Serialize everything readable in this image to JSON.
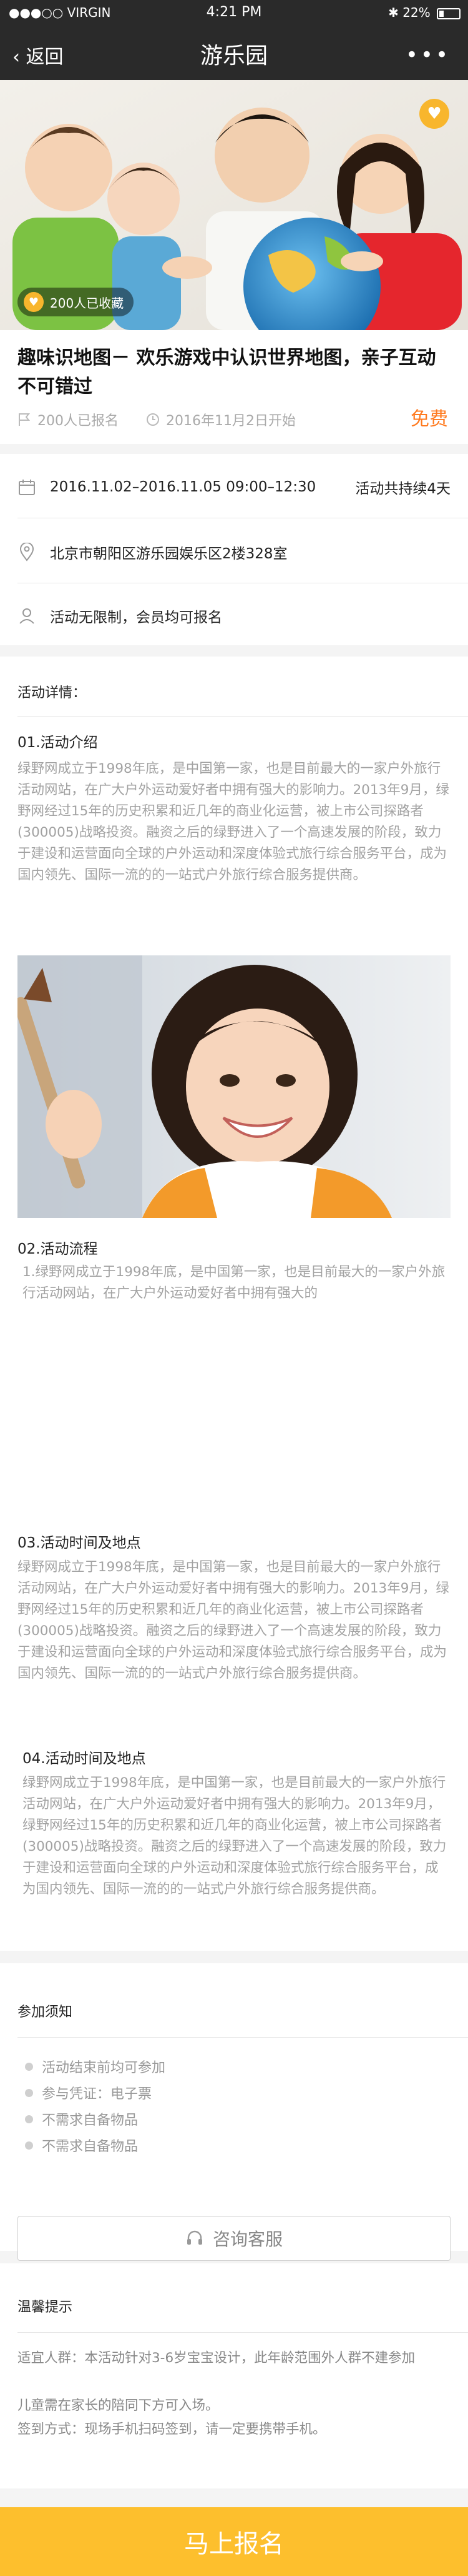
{
  "status_bar": {
    "carrier": "●●●○○ VIRGIN",
    "time": "4:21 PM",
    "battery": "22%"
  },
  "nav": {
    "back_label": "返回",
    "title": "游乐园",
    "more_label": "•••"
  },
  "hero": {
    "favorites_count": "200人已收藏"
  },
  "activity": {
    "title": "趣味识地图－ 欢乐游戏中认识世界地图，亲子互动不可错过",
    "signed_up": "200人已报名",
    "start": "2016年11月2日开始",
    "price": "免费"
  },
  "info": {
    "date_range": "2016.11.02–2016.11.05  09:00–12:30",
    "duration": "活动共持续4天",
    "address": "北京市朝阳区游乐园娱乐区2楼328室",
    "eligibility": "活动无限制，会员均可报名"
  },
  "details": {
    "heading": "活动详情：",
    "s1_title": "01.活动介绍",
    "s1_text": "绿野网成立于1998年底，是中国第一家，也是目前最大的一家户外旅行活动网站，在广大户外运动爱好者中拥有强大的影响力。2013年9月，绿野网经过15年的历史积累和近几年的商业化运营，被上市公司探路者(300005)战略投资。融资之后的绿野进入了一个高速发展的阶段，致力于建设和运营面向全球的户外运动和深度体验式旅行综合服务平台，成为国内领先、国际一流的的一站式户外旅行综合服务提供商。",
    "s2_title": "02.活动流程",
    "s2_item": "1.绿野网成立于1998年底，是中国第一家，也是目前最大的一家户外旅行活动网站，在广大户外运动爱好者中拥有强大的",
    "s3_title": "03.活动时间及地点",
    "s3_text": "绿野网成立于1998年底，是中国第一家，也是目前最大的一家户外旅行活动网站，在广大户外运动爱好者中拥有强大的影响力。2013年9月，绿野网经过15年的历史积累和近几年的商业化运营，被上市公司探路者(300005)战略投资。融资之后的绿野进入了一个高速发展的阶段，致力于建设和运营面向全球的户外运动和深度体验式旅行综合服务平台，成为国内领先、国际一流的的一站式户外旅行综合服务提供商。",
    "s4_title": "04.活动时间及地点",
    "s4_text": "绿野网成立于1998年底，是中国第一家，也是目前最大的一家户外旅行活动网站，在广大户外运动爱好者中拥有强大的影响力。2013年9月，绿野网经过15年的历史积累和近几年的商业化运营，被上市公司探路者(300005)战略投资。融资之后的绿野进入了一个高速发展的阶段，致力于建设和运营面向全球的户外运动和深度体验式旅行综合服务平台，成为国内领先、国际一流的的一站式户外旅行综合服务提供商。"
  },
  "notice": {
    "heading": "参加须知",
    "items": [
      "活动结束前均可参加",
      "参与凭证：电子票",
      "不需求自备物品",
      "不需求自备物品"
    ],
    "consult_label": "咨询客服"
  },
  "reminder": {
    "heading": "温馨提示",
    "line1": "适宜人群：本活动针对3-6岁宝宝设计，此年龄范围外人群不建参加",
    "line2": "儿童需在家长的陪同下方可入场。",
    "line3": "签到方式：现场手机扫码签到，请一定要携带手机。"
  },
  "cta": {
    "signup_label": "马上报名"
  },
  "colors": {
    "accent": "#ff7a1f",
    "cta": "#fdbf2d",
    "nav": "#2a2a2a"
  }
}
